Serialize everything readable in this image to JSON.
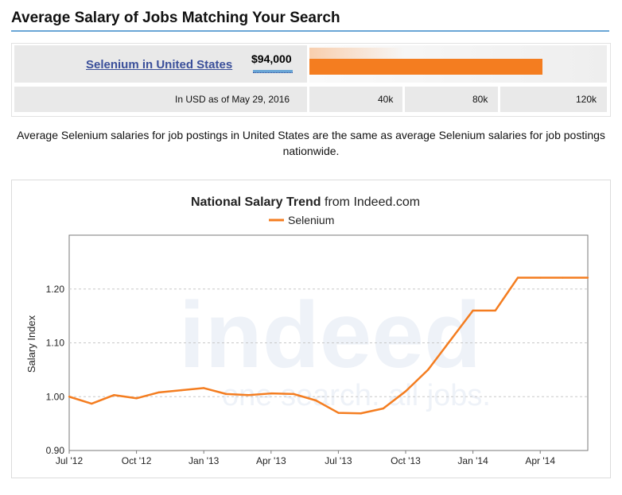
{
  "header": {
    "title": "Average Salary of Jobs Matching Your Search"
  },
  "salary_box": {
    "query_link": "Selenium in United States",
    "amount": "$94,000",
    "bar_fraction": 0.7833,
    "currency_note": "In USD as of May 29, 2016",
    "scale_labels": [
      "40k",
      "80k",
      "120k"
    ],
    "bar_color": "#f47d20"
  },
  "summary": "Average Selenium salaries for job postings in United States are the same as average Selenium salaries for job postings nationwide.",
  "chart_data": {
    "type": "line",
    "title_bold": "National Salary Trend",
    "title_rest": " from Indeed.com",
    "ylabel": "Salary Index",
    "xlabel": "",
    "ylim": [
      0.9,
      1.3
    ],
    "yticks": [
      0.9,
      1.0,
      1.1,
      1.2
    ],
    "ytick_labels": [
      "0.90",
      "1.00",
      "1.10",
      "1.20"
    ],
    "x_range": [
      "2012-07",
      "2014-07"
    ],
    "xtick_labels": [
      "Jul '12",
      "Oct '12",
      "Jan '13",
      "Apr '13",
      "Jul '13",
      "Oct '13",
      "Jan '14",
      "Apr '14"
    ],
    "grid": true,
    "legend": "top",
    "watermark": [
      "indeed",
      "one search. all jobs."
    ],
    "series": [
      {
        "name": "Selenium",
        "color": "#f47d20",
        "x": [
          "Jul '12",
          "Aug '12",
          "Sep '12",
          "Oct '12",
          "Nov '12",
          "Dec '12",
          "Jan '13",
          "Feb '13",
          "Mar '13",
          "Apr '13",
          "May '13",
          "Jun '13",
          "Jul '13",
          "Aug '13",
          "Sep '13",
          "Oct '13",
          "Nov '13",
          "Dec '13",
          "Jan '14",
          "Feb '14",
          "Mar '14",
          "Apr '14",
          "May '14",
          "Jun '14"
        ],
        "values": [
          1.0,
          0.987,
          1.003,
          0.997,
          1.008,
          1.012,
          1.016,
          1.005,
          1.003,
          1.006,
          1.005,
          0.993,
          0.97,
          0.969,
          0.978,
          1.01,
          1.05,
          1.105,
          1.16,
          1.16,
          1.221,
          1.221,
          1.221,
          1.221
        ]
      }
    ]
  }
}
